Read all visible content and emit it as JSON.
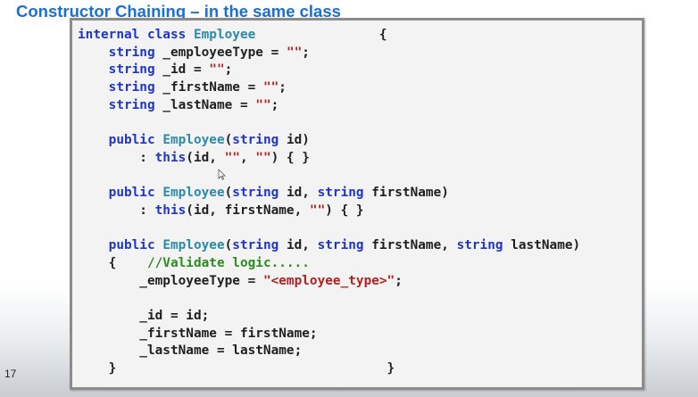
{
  "slide": {
    "title": "Constructor Chaining – in the same class",
    "page_number": "17"
  },
  "code_lines": [
    [
      {
        "t": "internal class ",
        "c": "keyword"
      },
      {
        "t": "Employee",
        "c": "type"
      },
      {
        "t": "                {",
        "c": "plain"
      }
    ],
    [
      {
        "t": "    ",
        "c": "plain"
      },
      {
        "t": "string",
        "c": "keyword"
      },
      {
        "t": " _employeeType = ",
        "c": "plain"
      },
      {
        "t": "\"\"",
        "c": "string"
      },
      {
        "t": ";",
        "c": "plain"
      }
    ],
    [
      {
        "t": "    ",
        "c": "plain"
      },
      {
        "t": "string",
        "c": "keyword"
      },
      {
        "t": " _id = ",
        "c": "plain"
      },
      {
        "t": "\"\"",
        "c": "string"
      },
      {
        "t": ";",
        "c": "plain"
      }
    ],
    [
      {
        "t": "    ",
        "c": "plain"
      },
      {
        "t": "string",
        "c": "keyword"
      },
      {
        "t": " _firstName = ",
        "c": "plain"
      },
      {
        "t": "\"\"",
        "c": "string"
      },
      {
        "t": ";",
        "c": "plain"
      }
    ],
    [
      {
        "t": "    ",
        "c": "plain"
      },
      {
        "t": "string",
        "c": "keyword"
      },
      {
        "t": " _lastName = ",
        "c": "plain"
      },
      {
        "t": "\"\"",
        "c": "string"
      },
      {
        "t": ";",
        "c": "plain"
      }
    ],
    [
      {
        "t": "",
        "c": "plain"
      }
    ],
    [
      {
        "t": "    ",
        "c": "plain"
      },
      {
        "t": "public ",
        "c": "keyword"
      },
      {
        "t": "Employee",
        "c": "type"
      },
      {
        "t": "(",
        "c": "plain"
      },
      {
        "t": "string",
        "c": "keyword"
      },
      {
        "t": " id)",
        "c": "plain"
      }
    ],
    [
      {
        "t": "        : ",
        "c": "plain"
      },
      {
        "t": "this",
        "c": "keyword"
      },
      {
        "t": "(id, ",
        "c": "plain"
      },
      {
        "t": "\"\"",
        "c": "string"
      },
      {
        "t": ", ",
        "c": "plain"
      },
      {
        "t": "\"\"",
        "c": "string"
      },
      {
        "t": ") { }",
        "c": "plain"
      }
    ],
    [
      {
        "t": "",
        "c": "plain"
      }
    ],
    [
      {
        "t": "    ",
        "c": "plain"
      },
      {
        "t": "public ",
        "c": "keyword"
      },
      {
        "t": "Employee",
        "c": "type"
      },
      {
        "t": "(",
        "c": "plain"
      },
      {
        "t": "string",
        "c": "keyword"
      },
      {
        "t": " id, ",
        "c": "plain"
      },
      {
        "t": "string",
        "c": "keyword"
      },
      {
        "t": " firstName)",
        "c": "plain"
      }
    ],
    [
      {
        "t": "        : ",
        "c": "plain"
      },
      {
        "t": "this",
        "c": "keyword"
      },
      {
        "t": "(id, firstName, ",
        "c": "plain"
      },
      {
        "t": "\"\"",
        "c": "string"
      },
      {
        "t": ") { }",
        "c": "plain"
      }
    ],
    [
      {
        "t": "",
        "c": "plain"
      }
    ],
    [
      {
        "t": "    ",
        "c": "plain"
      },
      {
        "t": "public ",
        "c": "keyword"
      },
      {
        "t": "Employee",
        "c": "type"
      },
      {
        "t": "(",
        "c": "plain"
      },
      {
        "t": "string",
        "c": "keyword"
      },
      {
        "t": " id, ",
        "c": "plain"
      },
      {
        "t": "string",
        "c": "keyword"
      },
      {
        "t": " firstName, ",
        "c": "plain"
      },
      {
        "t": "string",
        "c": "keyword"
      },
      {
        "t": " lastName)",
        "c": "plain"
      }
    ],
    [
      {
        "t": "    {    ",
        "c": "plain"
      },
      {
        "t": "//Validate logic.....",
        "c": "comment"
      }
    ],
    [
      {
        "t": "        _employeeType = ",
        "c": "plain"
      },
      {
        "t": "\"<employee_type>\"",
        "c": "string"
      },
      {
        "t": ";",
        "c": "plain"
      }
    ],
    [
      {
        "t": "",
        "c": "plain"
      }
    ],
    [
      {
        "t": "        _id = id;",
        "c": "plain"
      }
    ],
    [
      {
        "t": "        _firstName = firstName;",
        "c": "plain"
      }
    ],
    [
      {
        "t": "        _lastName = lastName;",
        "c": "plain"
      }
    ],
    [
      {
        "t": "    }                                   }",
        "c": "plain"
      }
    ]
  ],
  "colors": {
    "title": "#1a6fd4",
    "keyword": "#1f35c7",
    "type": "#2b8aa8",
    "string": "#b22222",
    "comment": "#2e8b22",
    "plain": "#1f1f1f"
  },
  "icons": {
    "cursor": "mouse-pointer-icon"
  }
}
